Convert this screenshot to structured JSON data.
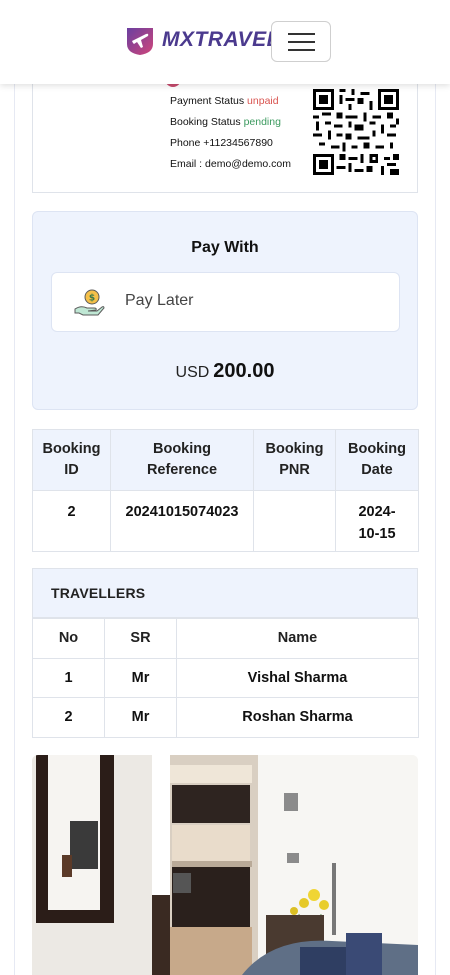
{
  "brand": {
    "name": "MXTRAVEL"
  },
  "ticket": {
    "payment_status_label": "Payment Status",
    "payment_status_value": "unpaid",
    "booking_status_label": "Booking Status",
    "booking_status_value": "pending",
    "phone_label": "Phone",
    "phone_value": "+11234567890",
    "email_label": "Email :",
    "email_value": "demo@demo.com"
  },
  "payment": {
    "title": "Pay With",
    "option_label": "Pay Later",
    "currency": "USD",
    "amount": "200.00"
  },
  "booking_table": {
    "headers": [
      {
        "line1": "Booking",
        "line2": "ID"
      },
      {
        "line1": "Booking",
        "line2": "Reference"
      },
      {
        "line1": "Booking",
        "line2": "PNR"
      },
      {
        "line1": "Booking",
        "line2": "Date"
      }
    ],
    "row": {
      "id": "2",
      "reference": "20241015074023",
      "pnr": "",
      "date_line1": "2024-",
      "date_line2": "10-15"
    }
  },
  "travellers": {
    "title": "TRAVELLERS",
    "headers": [
      "No",
      "SR",
      "Name"
    ],
    "rows": [
      {
        "no": "1",
        "sr": "Mr",
        "name": "Vishal Sharma"
      },
      {
        "no": "2",
        "sr": "Mr",
        "name": "Roshan Sharma"
      }
    ]
  },
  "colors": {
    "brand": "#4b3a8e",
    "accent_pink": "#c74b6d",
    "unpaid": "#d9534f",
    "pending": "#3c9a5f",
    "panel_bg": "#eef3fd"
  },
  "icons": [
    "logo-plane-icon",
    "hamburger-menu-icon",
    "qr-code-icon",
    "pay-later-hand-coin-icon"
  ]
}
